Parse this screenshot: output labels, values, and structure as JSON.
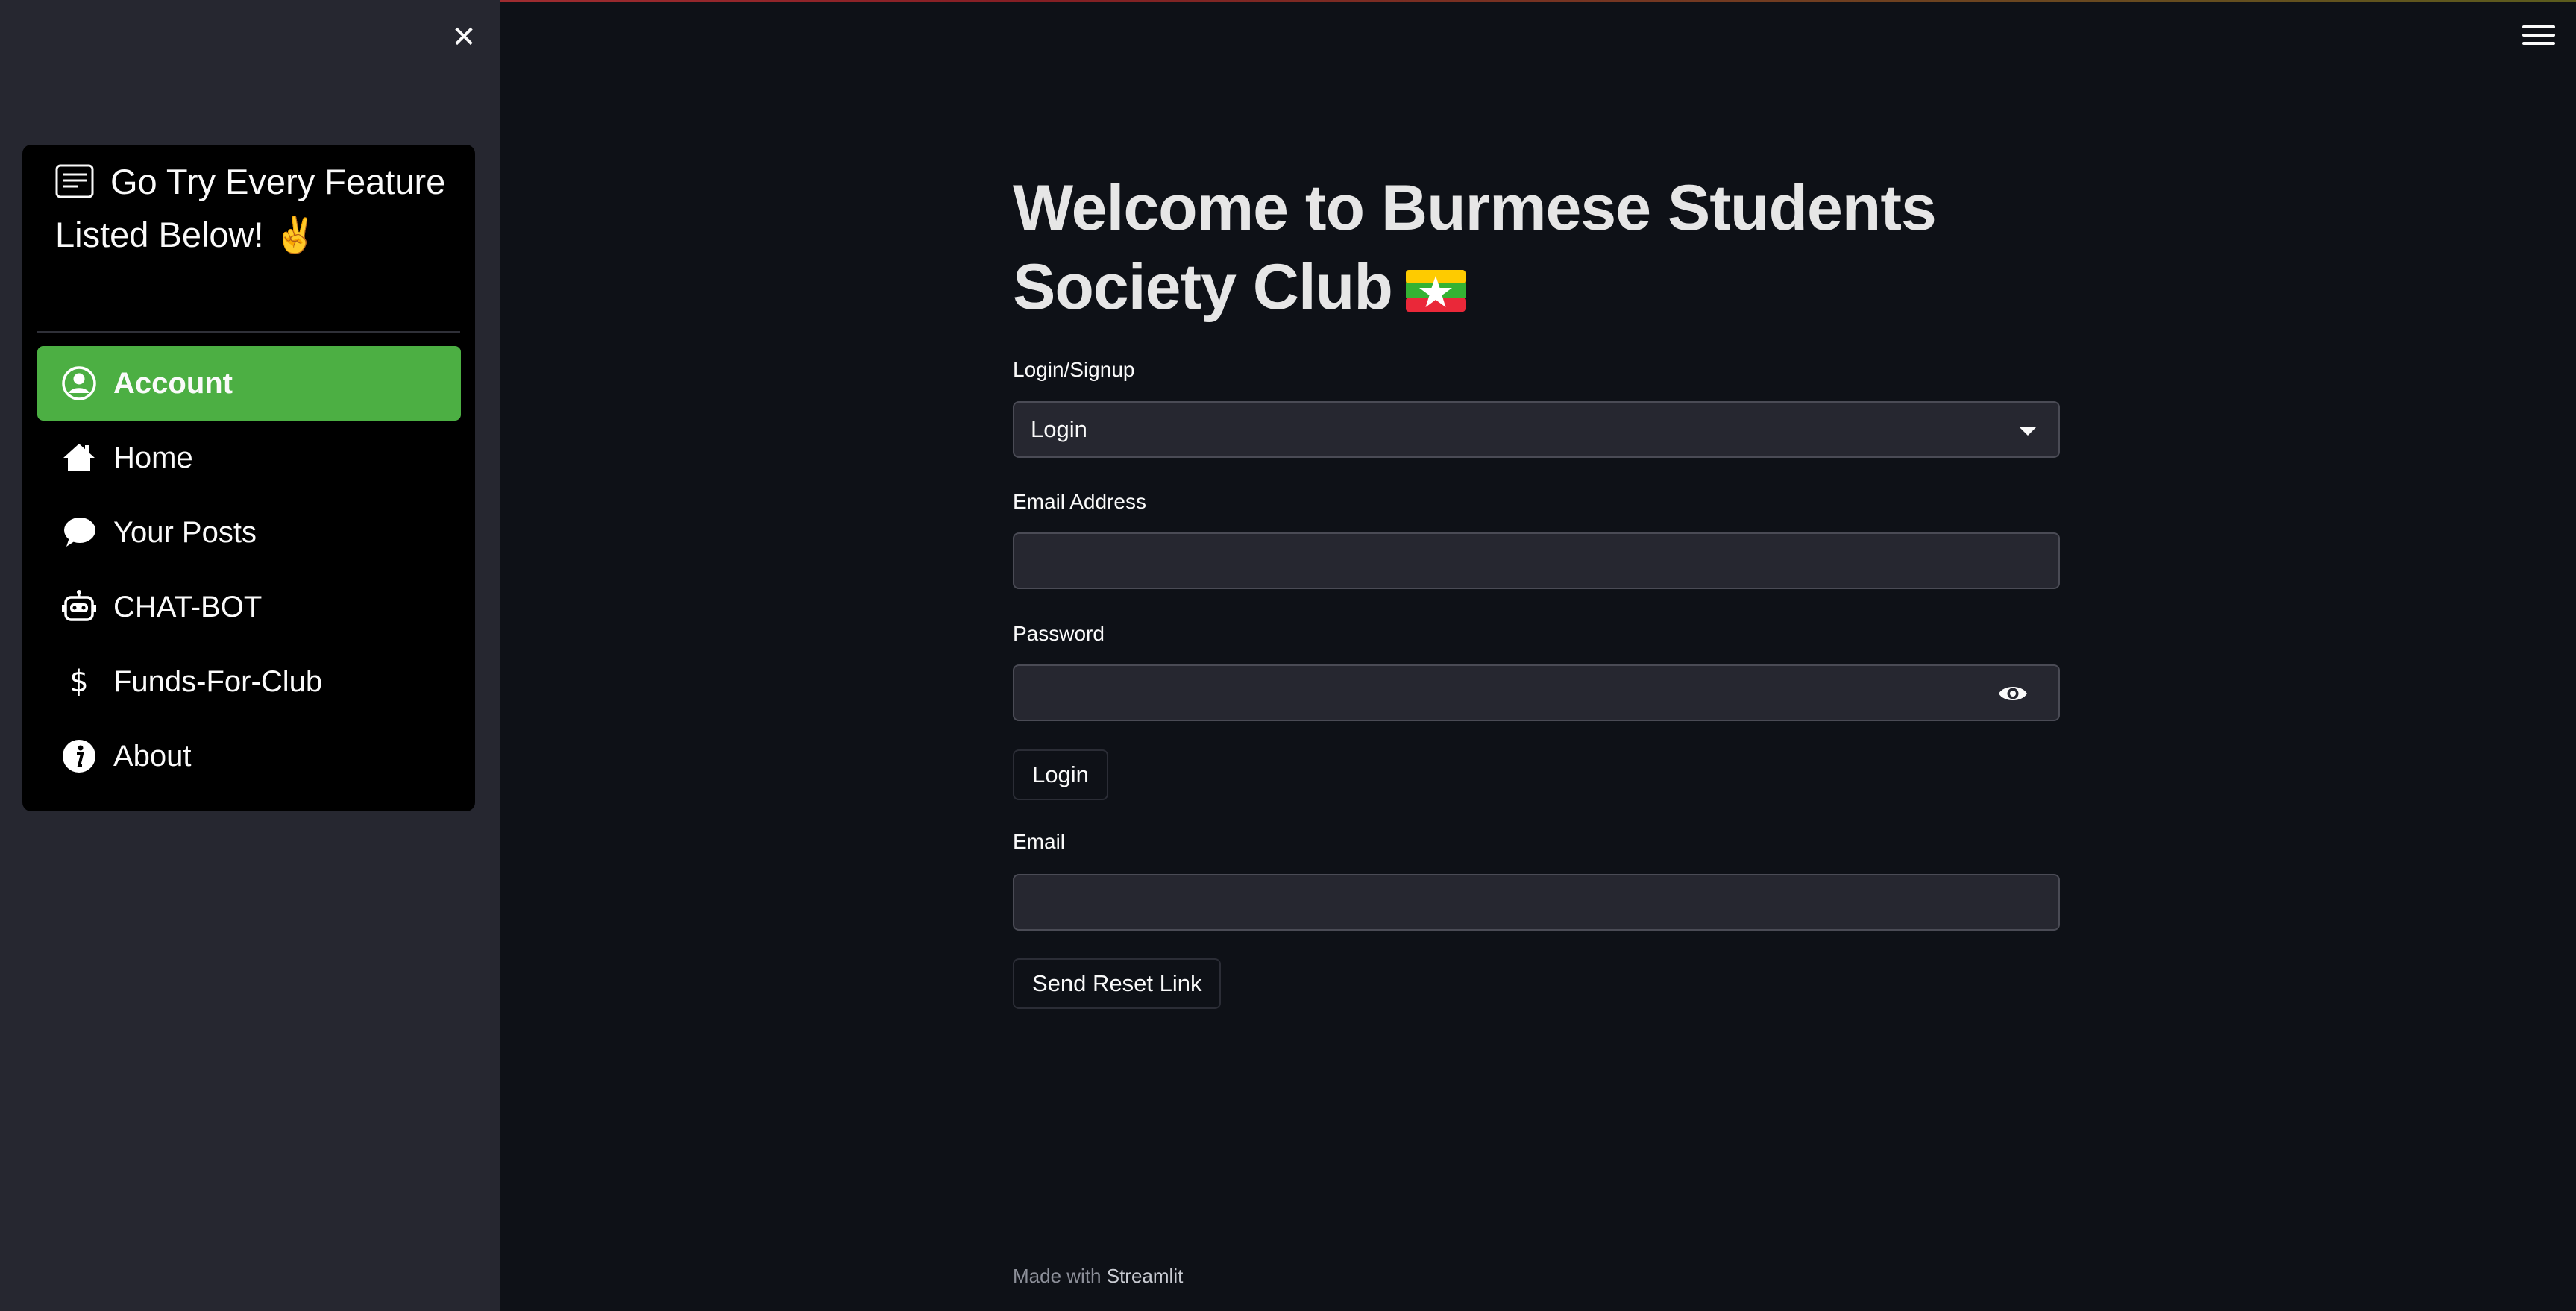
{
  "sidebar": {
    "close_icon": "close-icon",
    "menu_title": "Go Try Every Feature Listed Below! ✌️",
    "menu_title_icon": "card-text-icon",
    "items": [
      {
        "label": "Account",
        "icon": "person-circle-icon",
        "active": true
      },
      {
        "label": "Home",
        "icon": "house-icon",
        "active": false
      },
      {
        "label": "Your Posts",
        "icon": "chat-bubble-icon",
        "active": false
      },
      {
        "label": "CHAT-BOT",
        "icon": "robot-icon",
        "active": false
      },
      {
        "label": "Funds-For-Club",
        "icon": "dollar-icon",
        "active": false
      },
      {
        "label": "About",
        "icon": "info-circle-icon",
        "active": false
      }
    ],
    "active_color": "#4caf43"
  },
  "header": {
    "menu_icon": "hamburger-menu-icon"
  },
  "main": {
    "title": "Welcome to Burmese Students Society Club",
    "title_emoji": "myanmar-flag",
    "login_signup_label": "Login/Signup",
    "login_signup_value": "Login",
    "email_label": "Email Address",
    "email_value": "",
    "password_label": "Password",
    "password_value": "",
    "login_button": "Login",
    "reset_email_label": "Email",
    "reset_email_value": "",
    "reset_button": "Send Reset Link"
  },
  "footer": {
    "prefix": "Made with",
    "brand": "Streamlit"
  },
  "colors": {
    "background": "#0e1117",
    "sidebar": "#262730",
    "input_bg": "#262730"
  }
}
